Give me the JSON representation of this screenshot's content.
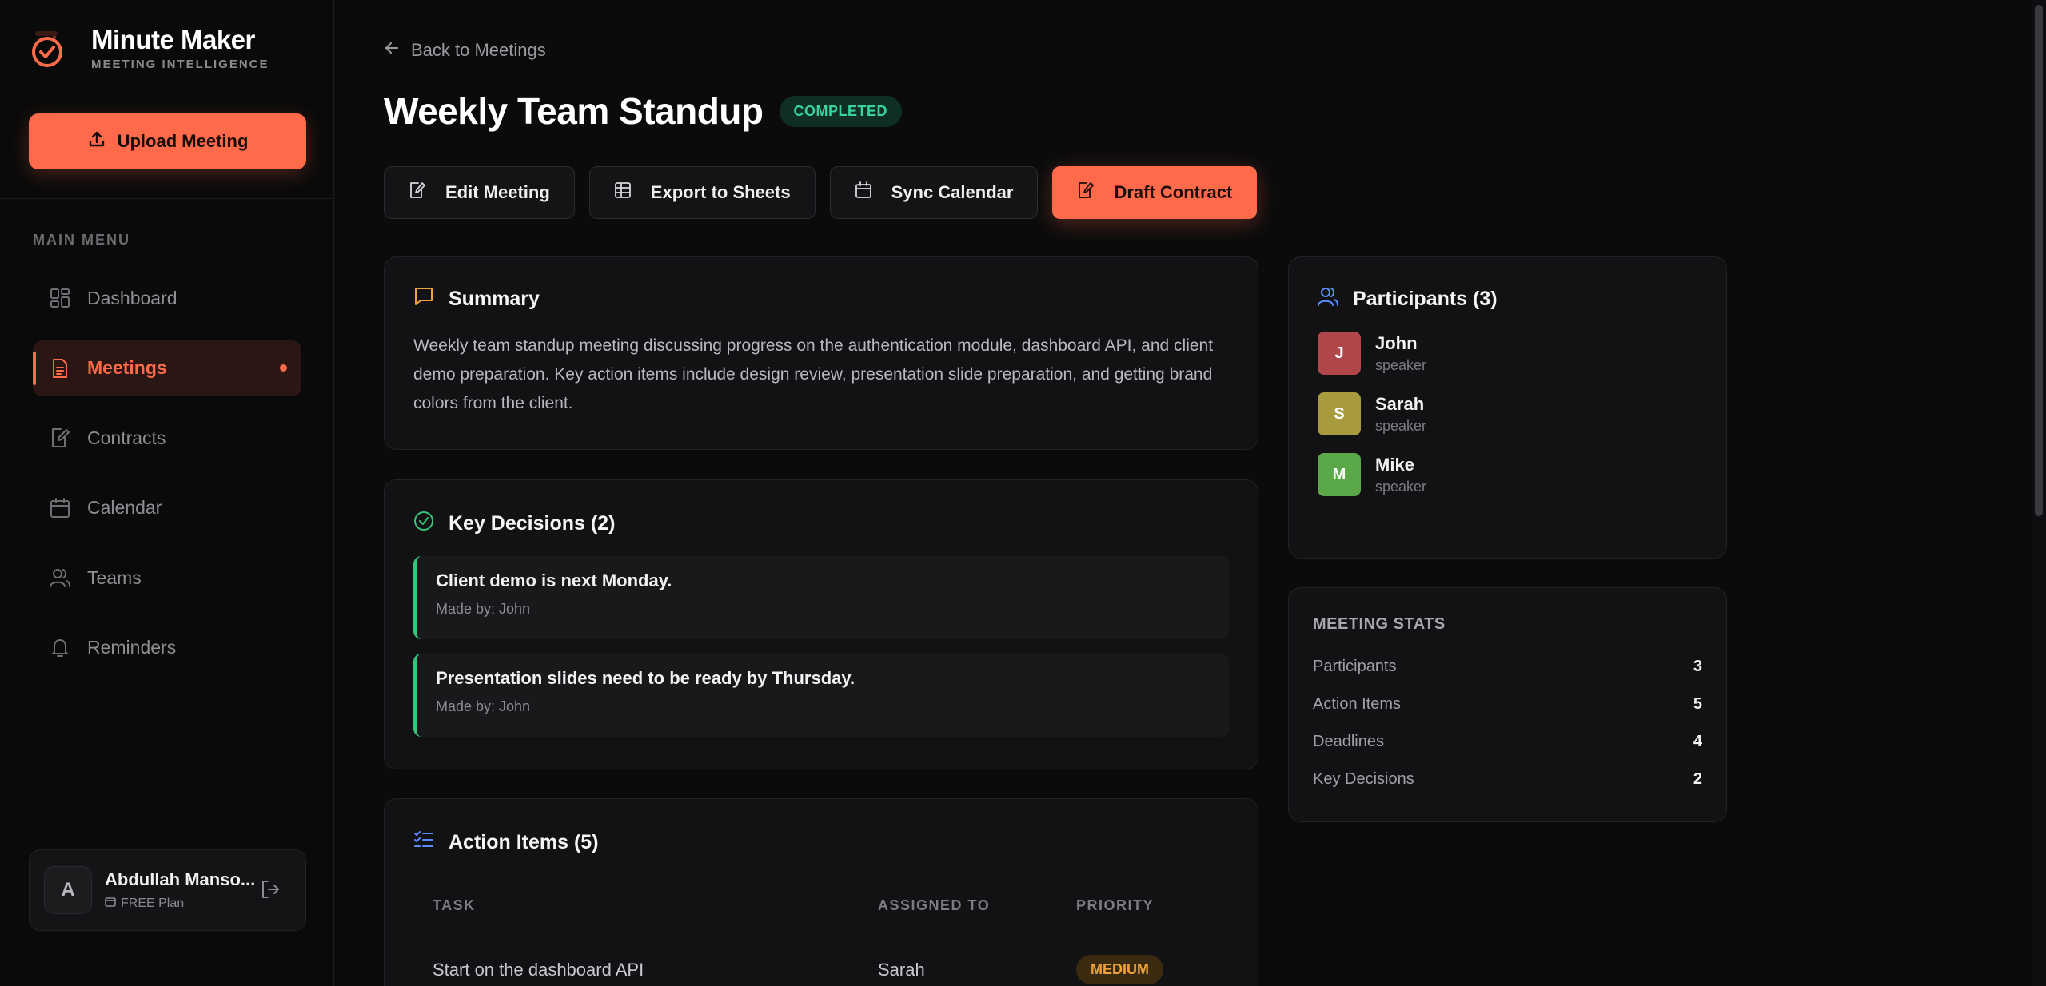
{
  "brand": {
    "name": "Minute Maker",
    "tagline": "MEETING INTELLIGENCE"
  },
  "sidebar": {
    "upload_label": "Upload Meeting",
    "menu_label": "MAIN MENU",
    "items": [
      {
        "label": "Dashboard",
        "icon": "dashboard-icon"
      },
      {
        "label": "Meetings",
        "icon": "document-icon",
        "active": true
      },
      {
        "label": "Contracts",
        "icon": "contract-icon"
      },
      {
        "label": "Calendar",
        "icon": "calendar-icon"
      },
      {
        "label": "Teams",
        "icon": "users-icon"
      },
      {
        "label": "Reminders",
        "icon": "bell-icon"
      }
    ],
    "user": {
      "initial": "A",
      "name": "Abdullah Manso...",
      "plan": "FREE Plan"
    }
  },
  "main": {
    "back_label": "Back to Meetings",
    "title": "Weekly Team Standup",
    "status": "COMPLETED",
    "actions": {
      "edit": "Edit Meeting",
      "export": "Export to Sheets",
      "sync": "Sync Calendar",
      "draft": "Draft Contract"
    },
    "summary": {
      "title": "Summary",
      "text": "Weekly team standup meeting discussing progress on the authentication module, dashboard API, and client demo preparation. Key action items include design review, presentation slide preparation, and getting brand colors from the client."
    },
    "decisions": {
      "title": "Key Decisions (2)",
      "items": [
        {
          "text": "Client demo is next Monday.",
          "by": "Made by: John"
        },
        {
          "text": "Presentation slides need to be ready by Thursday.",
          "by": "Made by: John"
        }
      ]
    },
    "action_items": {
      "title": "Action Items (5)",
      "columns": [
        "TASK",
        "ASSIGNED TO",
        "PRIORITY"
      ],
      "rows": [
        {
          "task": "Start on the dashboard API",
          "assignee": "Sarah",
          "priority": "MEDIUM"
        }
      ]
    },
    "participants": {
      "title": "Participants (3)",
      "people": [
        {
          "initial": "J",
          "name": "John",
          "role": "speaker",
          "color": "#b0464a"
        },
        {
          "initial": "S",
          "name": "Sarah",
          "role": "speaker",
          "color": "#a89a3e"
        },
        {
          "initial": "M",
          "name": "Mike",
          "role": "speaker",
          "color": "#5aa848"
        }
      ]
    },
    "stats": {
      "title": "MEETING STATS",
      "rows": [
        {
          "label": "Participants",
          "value": "3"
        },
        {
          "label": "Action Items",
          "value": "5"
        },
        {
          "label": "Deadlines",
          "value": "4"
        },
        {
          "label": "Key Decisions",
          "value": "2"
        }
      ]
    }
  },
  "colors": {
    "accent": "#ff6a4a",
    "success": "#38d39f",
    "decision": "#36c47a",
    "warning": "#f0a23a"
  }
}
